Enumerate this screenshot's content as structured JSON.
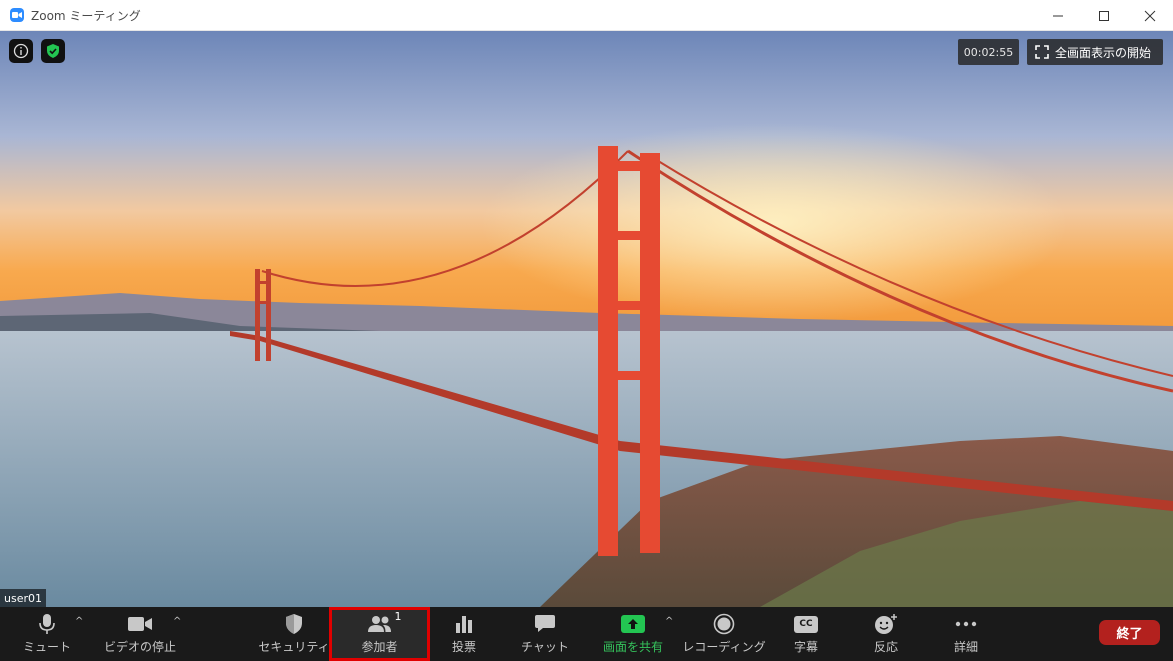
{
  "window": {
    "title": "Zoom ミーティング"
  },
  "overlay": {
    "timer": "00:02:55",
    "fullscreen_label": "全画面表示の開始",
    "participant_name": "user01"
  },
  "toolbar": {
    "mute": "ミュート",
    "video": "ビデオの停止",
    "security": "セキュリティ",
    "participants": "参加者",
    "participants_count": "1",
    "polls": "投票",
    "chat": "チャット",
    "share": "画面を共有",
    "record": "レコーディング",
    "captions": "字幕",
    "captions_icon_text": "CC",
    "reactions": "反応",
    "more": "詳細",
    "end": "終了"
  },
  "colors": {
    "accent": "#2D8CFF",
    "share_green": "#35c35c",
    "end_red": "#b3211e",
    "highlight_red": "#e00000"
  }
}
